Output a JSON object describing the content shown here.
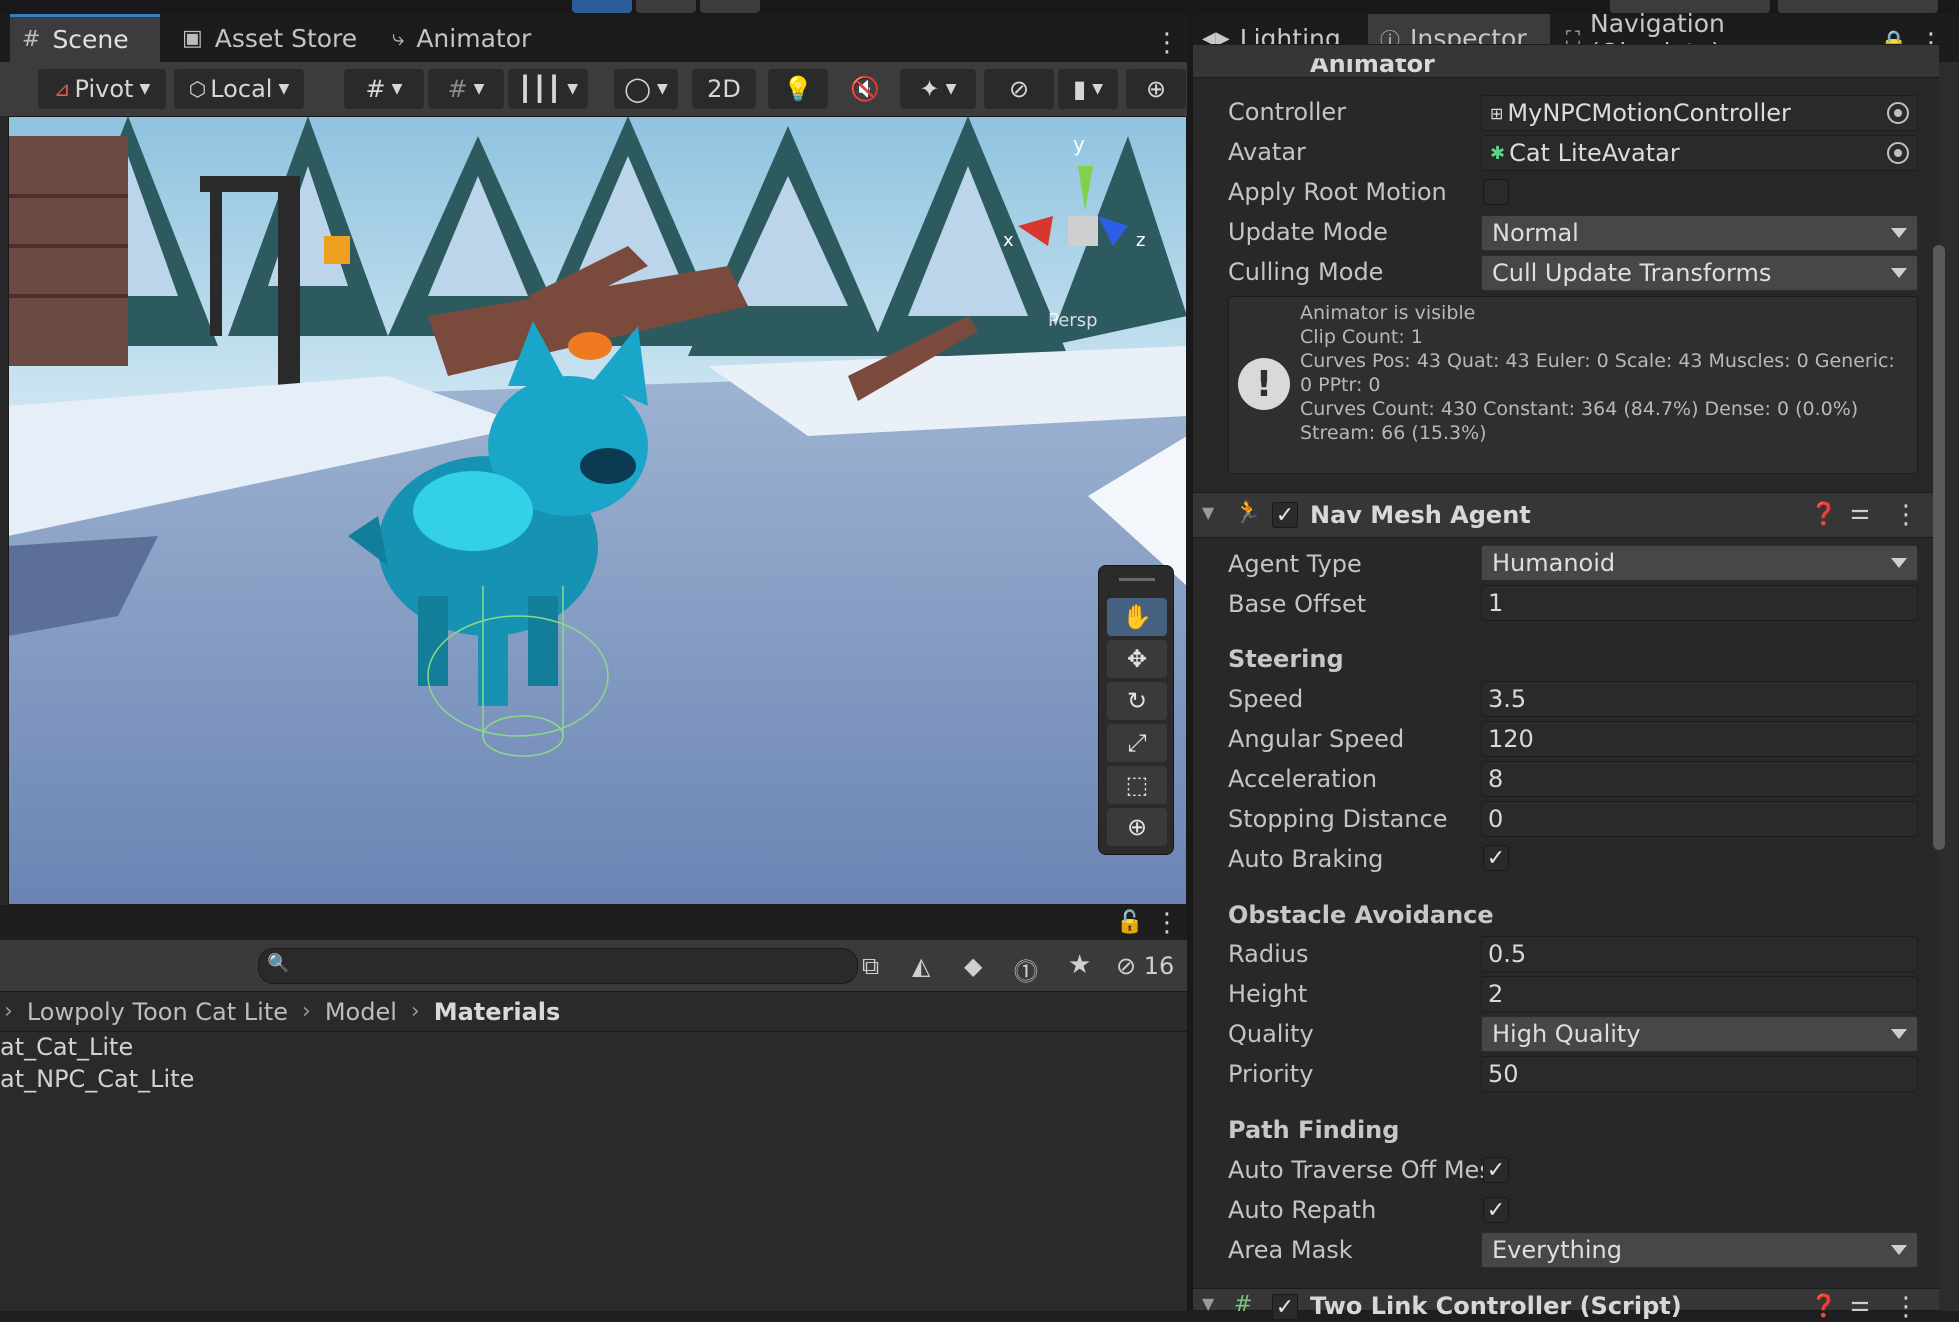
{
  "scene_tabs": {
    "scene": "Scene",
    "asset_store": "Asset Store",
    "animator": "Animator"
  },
  "scene_toolbar": {
    "pivot": "Pivot",
    "local": "Local",
    "mode_2d": "2D"
  },
  "viewport": {
    "gizmo_y": "y",
    "gizmo_x": "x",
    "gizmo_z": "z",
    "persp": "Persp"
  },
  "project": {
    "hidden_count": "16",
    "breadcrumb": [
      "Lowpoly Toon Cat Lite",
      "Model",
      "Materials"
    ],
    "files": [
      "at_Cat_Lite",
      "at_NPC_Cat_Lite"
    ]
  },
  "inspector_tabs": {
    "lighting": "Lighting",
    "inspector": "Inspector",
    "navigation": "Navigation (Obsolete)"
  },
  "animator": {
    "title": "Animator",
    "controller_label": "Controller",
    "controller_value": "MyNPCMotionController",
    "avatar_label": "Avatar",
    "avatar_value": "Cat LiteAvatar",
    "apply_root_motion_label": "Apply Root Motion",
    "apply_root_motion": false,
    "update_mode_label": "Update Mode",
    "update_mode_value": "Normal",
    "culling_mode_label": "Culling Mode",
    "culling_mode_value": "Cull Update Transforms",
    "info_lines": [
      "Animator is visible",
      "Clip Count: 1",
      "Curves Pos: 43 Quat: 43 Euler: 0 Scale: 43 Muscles: 0 Generic:",
      "0 PPtr: 0",
      "Curves Count: 430 Constant: 364 (84.7%) Dense: 0 (0.0%)",
      "Stream: 66 (15.3%)"
    ]
  },
  "nav_mesh_agent": {
    "title": "Nav Mesh Agent",
    "agent_type_label": "Agent Type",
    "agent_type_value": "Humanoid",
    "base_offset_label": "Base Offset",
    "base_offset_value": "1",
    "steering_title": "Steering",
    "speed_label": "Speed",
    "speed_value": "3.5",
    "angular_speed_label": "Angular Speed",
    "angular_speed_value": "120",
    "acceleration_label": "Acceleration",
    "acceleration_value": "8",
    "stopping_distance_label": "Stopping Distance",
    "stopping_distance_value": "0",
    "auto_braking_label": "Auto Braking",
    "obstacle_title": "Obstacle Avoidance",
    "radius_label": "Radius",
    "radius_value": "0.5",
    "height_label": "Height",
    "height_value": "2",
    "quality_label": "Quality",
    "quality_value": "High Quality",
    "priority_label": "Priority",
    "priority_value": "50",
    "pathfinding_title": "Path Finding",
    "auto_traverse_label": "Auto Traverse Off Mes",
    "auto_repath_label": "Auto Repath",
    "area_mask_label": "Area Mask",
    "area_mask_value": "Everything"
  },
  "two_link": {
    "title": "Two Link Controller (Script)"
  },
  "colors": {
    "accent": "#3a7ac8",
    "cat": "#1aa6c9",
    "snow": "#dfe9f5"
  }
}
